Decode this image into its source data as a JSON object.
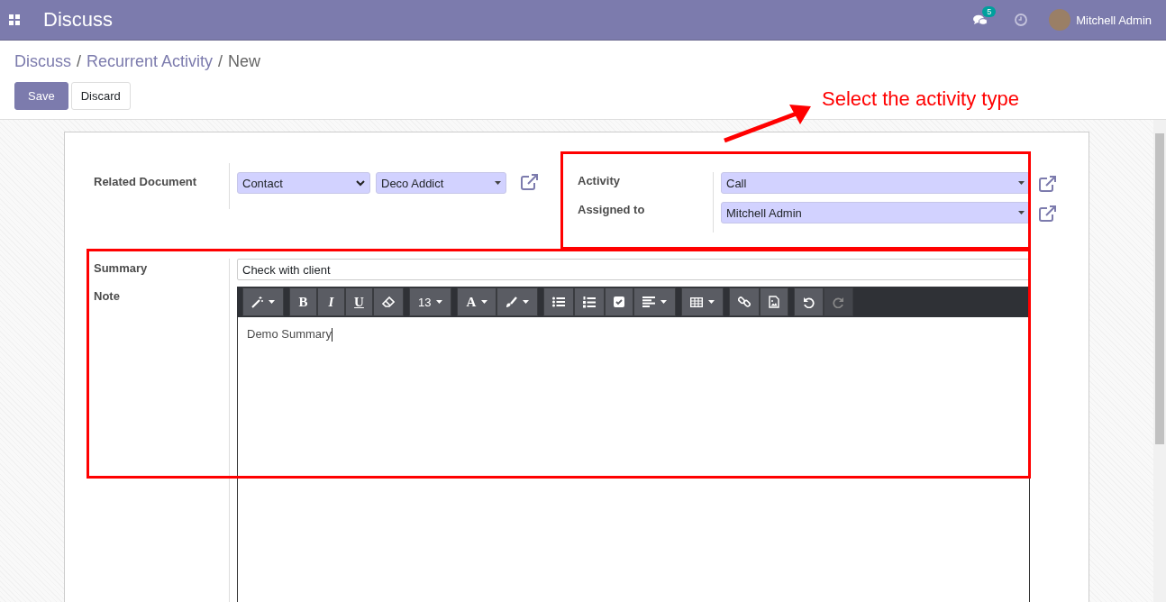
{
  "navbar": {
    "app_title": "Discuss",
    "messages_badge": "5",
    "user_name": "Mitchell Admin"
  },
  "breadcrumb": [
    {
      "label": "Discuss",
      "kind": "link"
    },
    {
      "label": "Recurrent Activity",
      "kind": "link"
    },
    {
      "label": "New",
      "kind": "current"
    }
  ],
  "breadcrumb_separator": "/",
  "buttons": [
    {
      "label": "Save",
      "kind": "primary"
    },
    {
      "label": "Discard",
      "kind": "secondary"
    }
  ],
  "form": {
    "related_document": {
      "label": "Related Document",
      "model": "Contact",
      "record": "Deco Addict"
    },
    "activity": {
      "label": "Activity",
      "value": "Call"
    },
    "assigned_to": {
      "label": "Assigned to",
      "value": "Mitchell Admin"
    },
    "summary": {
      "label": "Summary",
      "value": "Check with client"
    },
    "note": {
      "label": "Note",
      "value": "Demo Summary",
      "toolbar": [
        [
          {
            "kind": "magic",
            "dropdown": true,
            "disabled": false
          }
        ],
        [
          {
            "kind": "bold",
            "label": "B",
            "dropdown": false,
            "disabled": false
          },
          {
            "kind": "italic",
            "label": "I",
            "dropdown": false,
            "disabled": false
          },
          {
            "kind": "underline",
            "label": "U",
            "dropdown": false,
            "disabled": false
          },
          {
            "kind": "eraser",
            "dropdown": false,
            "disabled": false
          }
        ],
        [
          {
            "kind": "size",
            "label": "13",
            "dropdown": true,
            "disabled": false
          }
        ],
        [
          {
            "kind": "color",
            "label": "A",
            "dropdown": true,
            "disabled": false
          },
          {
            "kind": "brush",
            "dropdown": true,
            "disabled": false
          }
        ],
        [
          {
            "kind": "ul",
            "dropdown": false,
            "disabled": false
          },
          {
            "kind": "ol",
            "dropdown": false,
            "disabled": false
          },
          {
            "kind": "check",
            "dropdown": false,
            "disabled": false
          },
          {
            "kind": "align",
            "dropdown": true,
            "disabled": false
          }
        ],
        [
          {
            "kind": "table",
            "dropdown": true,
            "disabled": false
          }
        ],
        [
          {
            "kind": "link",
            "dropdown": false,
            "disabled": false
          },
          {
            "kind": "image",
            "dropdown": false,
            "disabled": false
          }
        ],
        [
          {
            "kind": "undo",
            "dropdown": false,
            "disabled": false
          },
          {
            "kind": "redo",
            "dropdown": false,
            "disabled": true
          }
        ]
      ]
    }
  },
  "annotation": {
    "text": "Select the activity type"
  }
}
